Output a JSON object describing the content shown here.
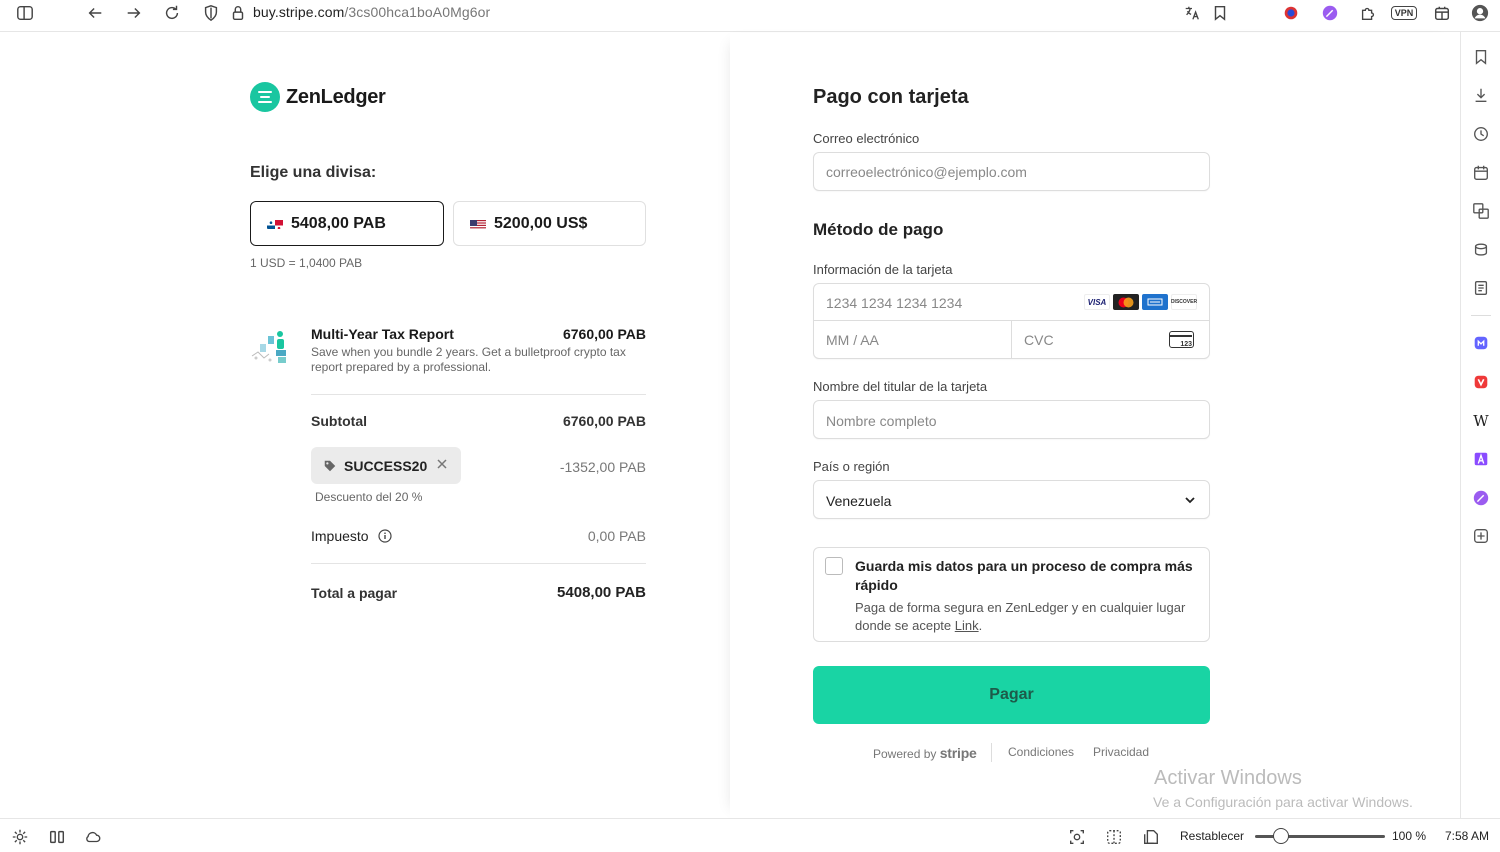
{
  "browser": {
    "url_host": "buy.stripe.com",
    "url_path": "/3cs00hca1boA0Mg6or",
    "vpn_label": "VPN"
  },
  "brand": {
    "name": "ZenLedger",
    "accent": "#19c6a0"
  },
  "currency": {
    "label": "Elige una divisa:",
    "options": [
      {
        "label": "5408,00 PAB",
        "flag": "panama-flag",
        "selected": true
      },
      {
        "label": "5200,00 US$",
        "flag": "us-flag",
        "selected": false
      }
    ],
    "rate": "1 USD = 1,0400 PAB"
  },
  "product": {
    "name": "Multi-Year Tax Report",
    "price": "6760,00 PAB",
    "description": "Save when you bundle 2 years. Get a bulletproof crypto tax report prepared by a professional."
  },
  "summary": {
    "subtotal_label": "Subtotal",
    "subtotal_value": "6760,00 PAB",
    "promo_code": "SUCCESS20",
    "promo_value": "-1352,00 PAB",
    "promo_note": "Descuento del 20 %",
    "tax_label": "Impuesto",
    "tax_value": "0,00 PAB",
    "total_label": "Total a pagar",
    "total_value": "5408,00 PAB"
  },
  "form": {
    "title": "Pago con tarjeta",
    "email_label": "Correo electrónico",
    "email_placeholder": "correoelectrónico@ejemplo.com",
    "method_title": "Método de pago",
    "card_label": "Información de la tarjeta",
    "card_placeholder": "1234 1234 1234 1234",
    "expiry_placeholder": "MM / AA",
    "cvc_placeholder": "CVC",
    "card_brands": [
      "VISA",
      "mastercard",
      "AMEX",
      "DISCOVER"
    ],
    "cvc_badge": "123",
    "holder_label": "Nombre del titular de la tarjeta",
    "holder_placeholder": "Nombre completo",
    "country_label": "País o región",
    "country_value": "Venezuela",
    "save_title": "Guarda mis datos para un proceso de compra más rápido",
    "save_desc_prefix": "Paga de forma segura en ZenLedger y en cualquier lugar donde se acepte ",
    "save_desc_link": "Link",
    "save_desc_suffix": ".",
    "pay_label": "Pagar",
    "pay_color": "#19d4a4"
  },
  "footer": {
    "powered_by": "Powered by",
    "stripe": "stripe",
    "terms": "Condiciones",
    "privacy": "Privacidad"
  },
  "watermark": {
    "title": "Activar Windows",
    "subtitle": "Ve a Configuración para activar Windows."
  },
  "statusbar": {
    "reset_label": "Restablecer",
    "zoom": "100 %",
    "zoom_level": 0.2,
    "time": "7:58 AM"
  }
}
